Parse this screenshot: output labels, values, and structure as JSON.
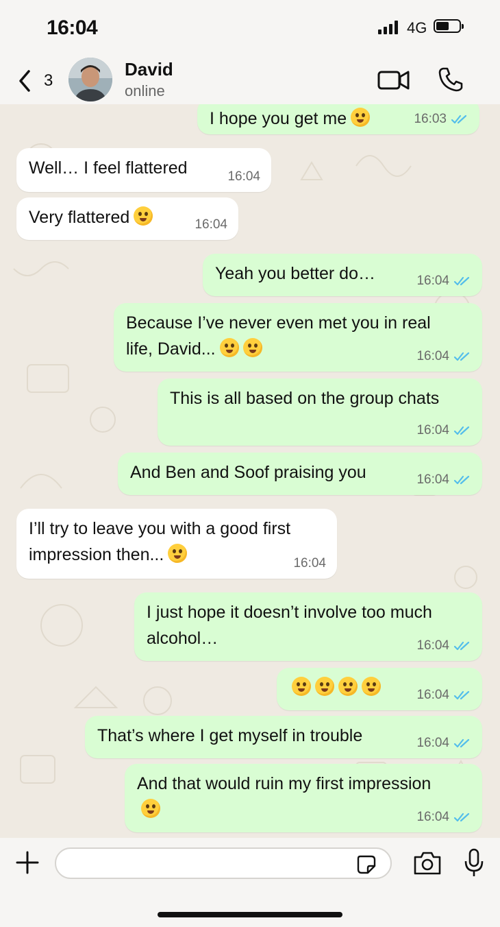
{
  "status_bar": {
    "time": "16:04",
    "network": "4G"
  },
  "header": {
    "back_count": "3",
    "contact_name": "David",
    "contact_status": "online"
  },
  "messages": [
    {
      "dir": "out",
      "text": "I hope you get me",
      "emoji_count": 1,
      "time": "16:03"
    },
    {
      "dir": "in",
      "text": "Well… I feel flattered",
      "emoji_count": 0,
      "time": "16:04"
    },
    {
      "dir": "in",
      "text": "Very flattered",
      "emoji_count": 1,
      "time": "16:04"
    },
    {
      "dir": "out",
      "text": "Yeah you better do…",
      "emoji_count": 0,
      "time": "16:04"
    },
    {
      "dir": "out",
      "text": "Because I’ve never even met you in real\nlife, David...",
      "emoji_count": 2,
      "time": "16:04"
    },
    {
      "dir": "out",
      "text": "This is all based on the group chats",
      "emoji_count": 0,
      "time": "16:04"
    },
    {
      "dir": "out",
      "text": "And Ben and Soof praising you",
      "emoji_count": 0,
      "time": "16:04"
    },
    {
      "dir": "in",
      "text": "I’ll try to leave you with a good first\nimpression then...",
      "emoji_count": 1,
      "time": "16:04"
    },
    {
      "dir": "out",
      "text": "I just hope it doesn’t involve too much\nalcohol…",
      "emoji_count": 0,
      "time": "16:04"
    },
    {
      "dir": "out",
      "text": "",
      "emoji_count": 4,
      "time": "16:04"
    },
    {
      "dir": "out",
      "text": "That’s where I get myself in trouble",
      "emoji_count": 0,
      "time": "16:04"
    },
    {
      "dir": "out",
      "text": "And that would ruin my first impression\n",
      "emoji_count": 1,
      "time": "16:04"
    }
  ],
  "input": {
    "placeholder": ""
  },
  "colors": {
    "outgoing_bubble": "#d9fdd3",
    "incoming_bubble": "#ffffff",
    "read_ticks": "#53bdeb",
    "chat_background": "#efeae2"
  },
  "icons": [
    "back-chevron-icon",
    "video-call-icon",
    "phone-icon",
    "plus-icon",
    "sticker-icon",
    "camera-icon",
    "microphone-icon",
    "read-receipt-icon",
    "emoji-icon"
  ]
}
